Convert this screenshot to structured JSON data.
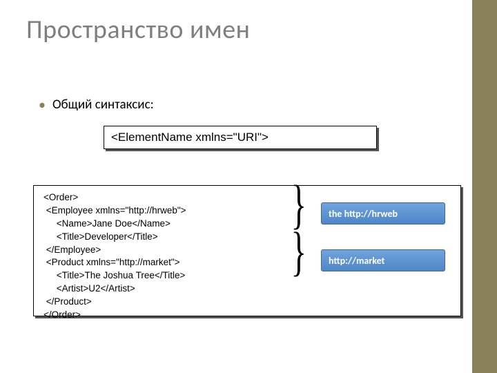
{
  "title": "Пространство имен",
  "bullet": "Общий синтаксис:",
  "syntax": "<ElementName xmlns=\"URI\">",
  "code": "<Order>\n <Employee xmlns=\"http://hrweb\">\n     <Name>Jane Doe</Name>\n     <Title>Developer</Title>\n </Employee>\n <Product xmlns=\"http://market\">\n     <Title>The Joshua Tree</Title>\n     <Artist>U2</Artist>\n </Product>\n</Order>",
  "labels": {
    "hrweb": "the http://hrweb",
    "market": "http://market"
  },
  "brace": "}"
}
